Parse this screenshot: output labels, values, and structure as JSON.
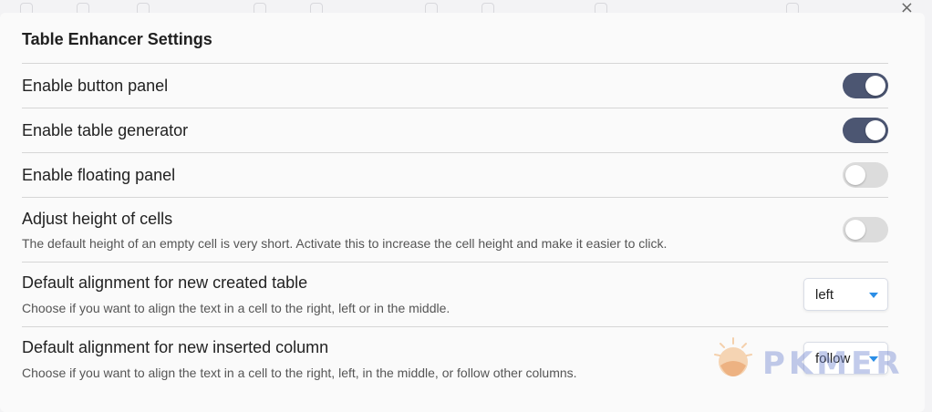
{
  "modal": {
    "title": "Table Enhancer Settings",
    "close_glyph": "×"
  },
  "settings": [
    {
      "label": "Enable button panel",
      "type": "toggle",
      "enabled": true
    },
    {
      "label": "Enable table generator",
      "type": "toggle",
      "enabled": true
    },
    {
      "label": "Enable floating panel",
      "type": "toggle",
      "enabled": false
    },
    {
      "label": "Adjust height of cells",
      "description": "The default height of an empty cell is very short. Activate this to increase the cell height and make it easier to click.",
      "type": "toggle",
      "enabled": false
    },
    {
      "label": "Default alignment for new created table",
      "description": "Choose if you want to align the text in a cell to the right, left or in the middle.",
      "type": "dropdown",
      "value": "left"
    },
    {
      "label": "Default alignment for new inserted column",
      "description": "Choose if you want to align the text in a cell to the right, left, in the middle, or follow other columns.",
      "type": "dropdown",
      "value": "follow"
    }
  ],
  "watermark": {
    "text": "PKMER"
  },
  "colors": {
    "toggle_on": "#4c5672",
    "toggle_off": "#dcdcdc",
    "dropdown_caret": "#2b8ee6"
  }
}
